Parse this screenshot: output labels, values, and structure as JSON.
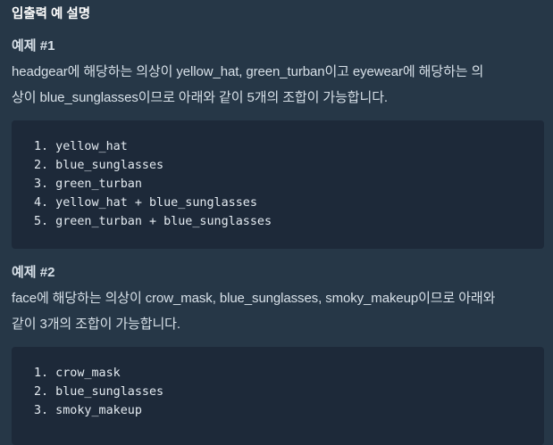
{
  "section_title": "입출력 예 설명",
  "examples": [
    {
      "heading": "예제 #1",
      "description_lines": [
        "headgear에 해당하는 의상이 yellow_hat, green_turban이고 eyewear에 해당하는 의",
        "상이 blue_sunglasses이므로 아래와 같이 5개의 조합이 가능합니다."
      ],
      "code_lines": [
        "1. yellow_hat",
        "2. blue_sunglasses",
        "3. green_turban",
        "4. yellow_hat + blue_sunglasses",
        "5. green_turban + blue_sunglasses"
      ]
    },
    {
      "heading": "예제 #2",
      "description_lines": [
        "face에 해당하는 의상이 crow_mask, blue_sunglasses, smoky_makeup이므로 아래와",
        "같이 3개의 조합이 가능합니다."
      ],
      "code_lines": [
        "1. crow_mask",
        "2. blue_sunglasses",
        "3. smoky_makeup"
      ]
    }
  ]
}
